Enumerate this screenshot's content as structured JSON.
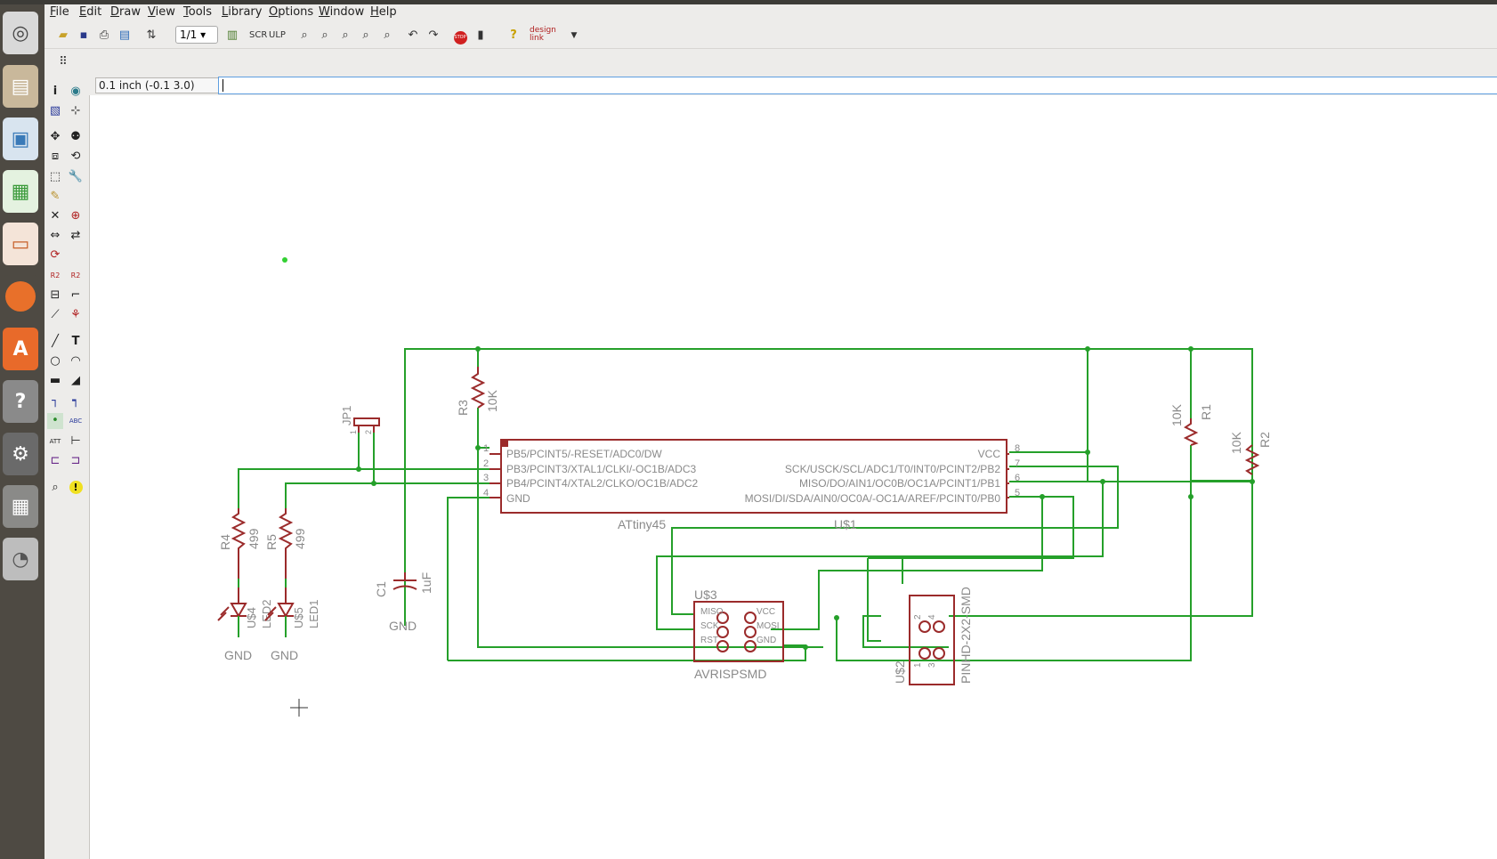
{
  "menu": [
    "File",
    "Edit",
    "Draw",
    "View",
    "Tools",
    "Library",
    "Options",
    "Window",
    "Help"
  ],
  "toolbar": {
    "page_select": "1/1",
    "designlink": "design link"
  },
  "coord": "0.1 inch (-0.1 3.0)",
  "command": "",
  "schematic": {
    "ic": {
      "name": "ATtiny45",
      "ref": "U$1",
      "left_pins": [
        "PB5/PCINT5/-RESET/ADC0/DW",
        "PB3/PCINT3/XTAL1/CLKI/-OC1B/ADC3",
        "PB4/PCINT4/XTAL2/CLKO/OC1B/ADC2",
        "GND"
      ],
      "left_nums": [
        "1",
        "2",
        "3",
        "4"
      ],
      "right_pins": [
        "VCC",
        "SCK/USCK/SCL/ADC1/T0/INT0/PCINT2/PB2",
        "MISO/DO/AIN1/OC0B/OC1A/PCINT1/PB1",
        "MOSI/DI/SDA/AIN0/OC0A/-OC1A/AREF/PCINT0/PB0"
      ],
      "right_nums": [
        "8",
        "7",
        "6",
        "5"
      ]
    },
    "r3": {
      "ref": "R3",
      "val": "10K"
    },
    "r1": {
      "ref": "R1",
      "val": "10K"
    },
    "r2": {
      "ref": "R2",
      "val": "10K"
    },
    "r4": {
      "ref": "R4",
      "val": "499"
    },
    "r5": {
      "ref": "R5",
      "val": "499"
    },
    "jp1": {
      "ref": "JP1",
      "p1": "1",
      "p2": "2"
    },
    "c1": {
      "ref": "C1",
      "val": "1uF",
      "gnd": "GND"
    },
    "led2": {
      "ref": "U$4",
      "val": "LED2",
      "gnd": "GND"
    },
    "led1": {
      "ref": "U$5",
      "val": "LED1",
      "gnd": "GND"
    },
    "isp": {
      "ref": "U$3",
      "name": "AVRISPSMD",
      "pins": [
        "MISO",
        "VCC",
        "SCK",
        "MOSI",
        "RST",
        "GND"
      ]
    },
    "pinhd": {
      "ref": "U$2",
      "name": "PINHD-2X2-SMD",
      "pins": [
        "2",
        "4",
        "1",
        "3"
      ]
    }
  },
  "colors": {
    "wire": "#25a02a",
    "part": "#9b2b2b",
    "text": "#8a8a8a"
  }
}
